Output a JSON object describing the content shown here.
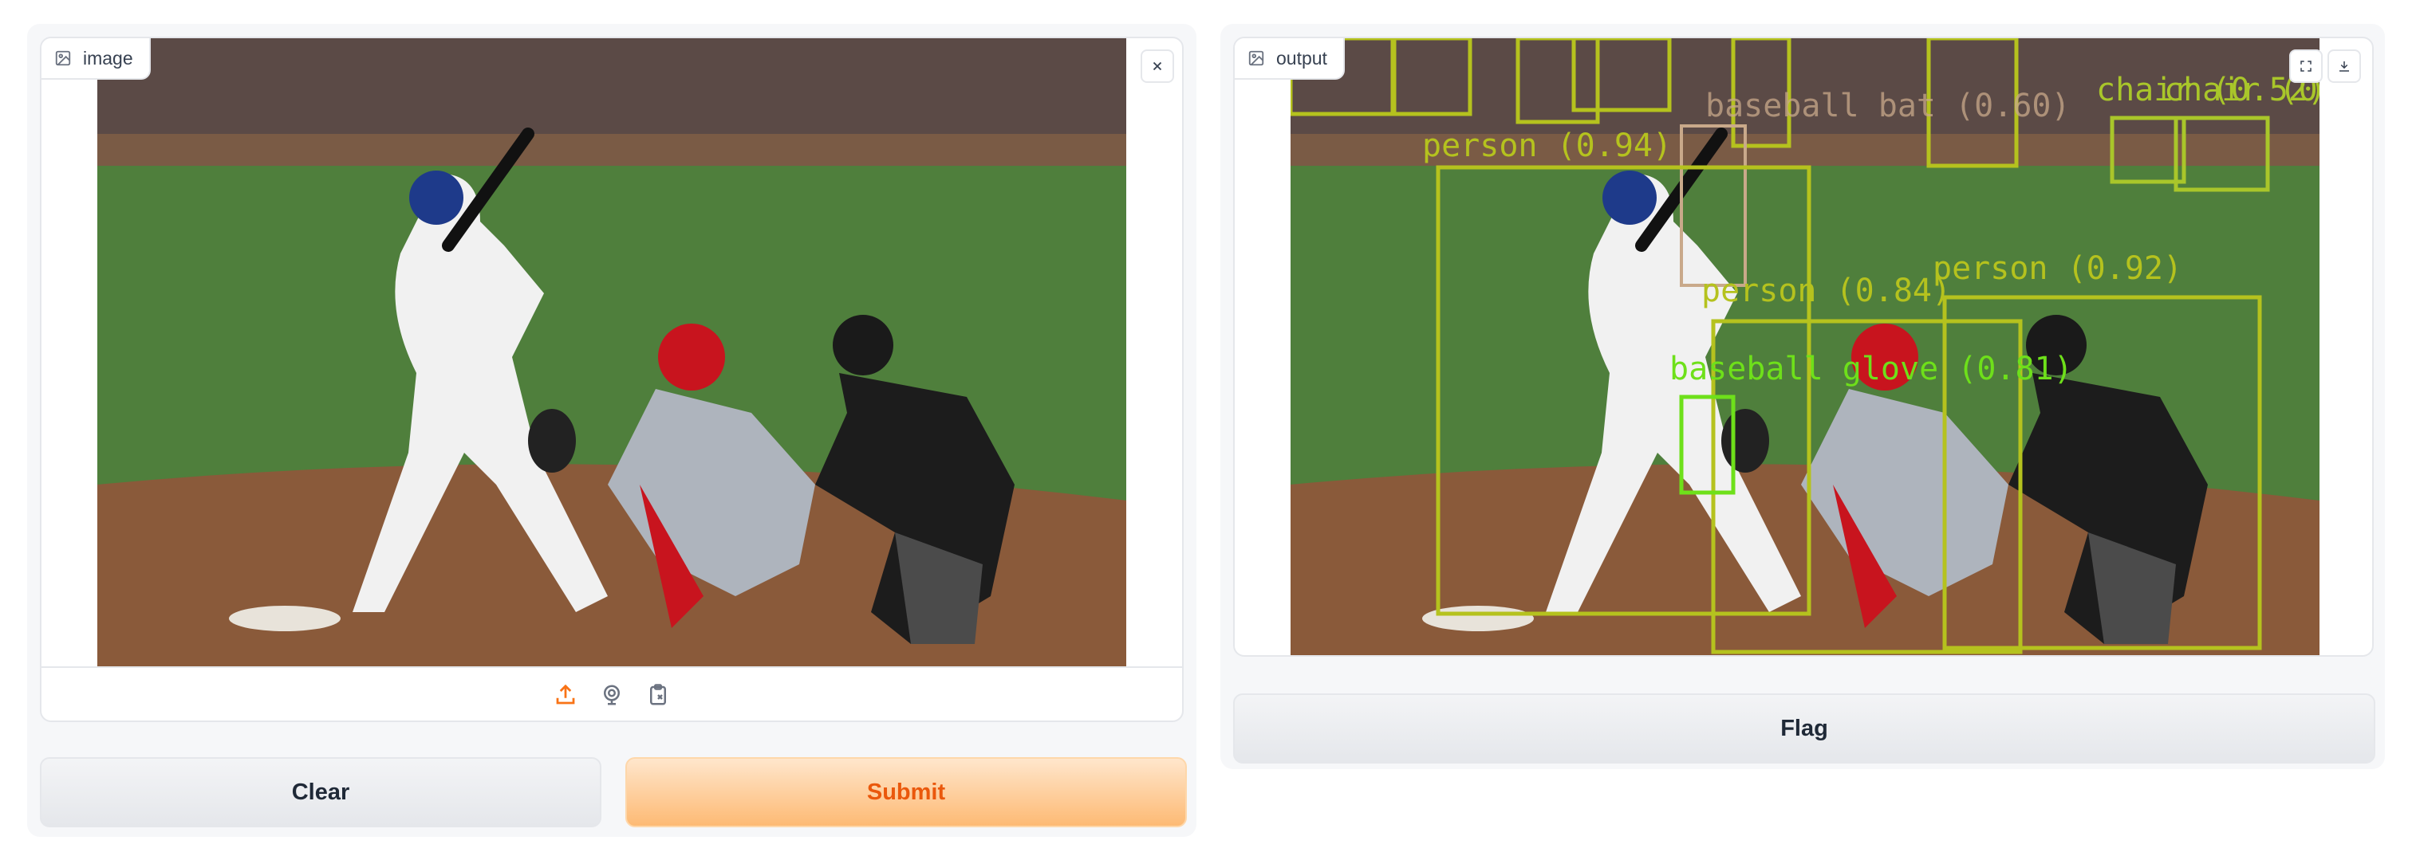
{
  "input_panel": {
    "label": "image",
    "label_icon": "image-icon",
    "close_icon": "close-icon",
    "source_icons": [
      "upload-icon",
      "webcam-icon",
      "clipboard-icon"
    ],
    "clear_label": "Clear",
    "submit_label": "Submit"
  },
  "output_panel": {
    "label": "output",
    "label_icon": "image-icon",
    "fullscreen_icon": "fullscreen-icon",
    "download_icon": "download-icon",
    "flag_label": "Flag",
    "detections": [
      {
        "label": "person (0.94)",
        "color": "#b5c21e"
      },
      {
        "label": "person (0.84)",
        "color": "#b5c21e"
      },
      {
        "label": "person (0.92)",
        "color": "#b5c21e"
      },
      {
        "label": "baseball glove (0.81)",
        "color": "#6ee01a"
      },
      {
        "label": "baseball bat (0.60)",
        "color": "#c9a98a"
      },
      {
        "label": "chair (0.52)",
        "color": "#a9c62a"
      },
      {
        "label": "chair (0.50)",
        "color": "#a9c62a"
      }
    ]
  },
  "colors": {
    "accent": "#f97316",
    "border": "#e5e7eb",
    "panel_bg": "#f6f7f9"
  }
}
